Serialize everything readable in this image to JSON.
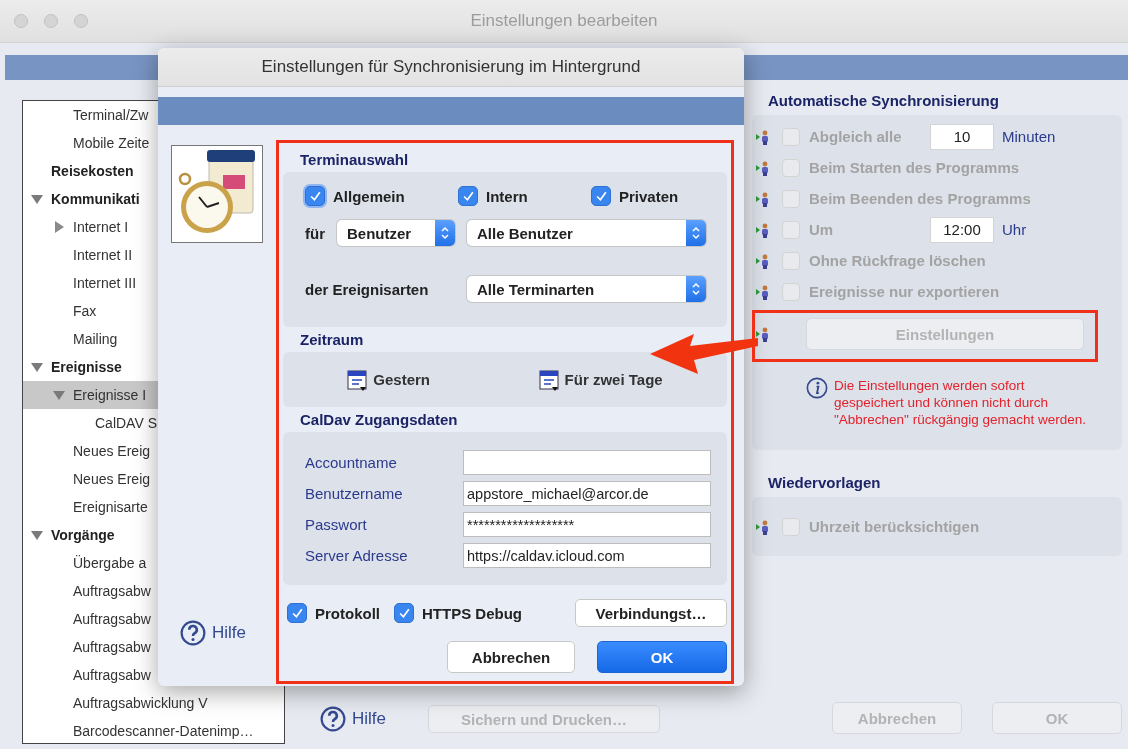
{
  "window": {
    "title": "Einstellungen bearbeiten"
  },
  "tree": [
    {
      "label": "Terminal/Zw",
      "kind": "item",
      "selected": false
    },
    {
      "label": "Mobile Zeite",
      "kind": "item",
      "selected": false
    },
    {
      "label": "Reisekosten",
      "kind": "category",
      "selected": false
    },
    {
      "label": "Kommunikati",
      "kind": "category",
      "selected": false,
      "expanded": true,
      "children": [
        {
          "label": "Internet I",
          "selected": false,
          "expanded": false
        },
        {
          "label": "Internet II",
          "selected": false
        },
        {
          "label": "Internet III",
          "selected": false
        },
        {
          "label": "Fax",
          "selected": false
        },
        {
          "label": "Mailing",
          "selected": false
        }
      ]
    },
    {
      "label": "Ereignisse",
      "kind": "category",
      "selected": false,
      "expanded": true,
      "children": [
        {
          "label": "Ereignisse I",
          "selected": true,
          "expanded": true,
          "children": [
            {
              "label": "CalDAV S",
              "selected": false
            }
          ]
        },
        {
          "label": "Neues Ereig",
          "selected": false
        },
        {
          "label": "Neues Ereig",
          "selected": false
        },
        {
          "label": "Ereignisarte",
          "selected": false
        }
      ]
    },
    {
      "label": "Vorgänge",
      "kind": "category",
      "selected": false,
      "expanded": true,
      "children": [
        {
          "label": "Übergabe a",
          "selected": false
        },
        {
          "label": "Auftragsabw",
          "selected": false
        },
        {
          "label": "Auftragsabw",
          "selected": false
        },
        {
          "label": "Auftragsabw",
          "selected": false
        },
        {
          "label": "Auftragsabw",
          "selected": false
        },
        {
          "label": "Auftragsabwicklung V",
          "selected": false
        },
        {
          "label": "Barcodescanner-Datenimp…",
          "selected": false
        }
      ]
    }
  ],
  "back_footer": {
    "help": "Hilfe",
    "print_button": {
      "label": "Sichern und Drucken…",
      "disabled": true
    }
  },
  "auto_sync": {
    "title": "Automatische Synchronisierung",
    "rows": [
      {
        "kind": "input",
        "label": "Abgleich alle",
        "checked": false,
        "disabled": true,
        "value": "10",
        "unit": "Minuten"
      },
      {
        "kind": "check",
        "label": "Beim Starten des Programms",
        "checked": false,
        "disabled": true
      },
      {
        "kind": "check",
        "label": "Beim Beenden des Programms",
        "checked": false,
        "disabled": true
      },
      {
        "kind": "input",
        "label": "Um",
        "checked": false,
        "disabled": true,
        "value": "12:00",
        "unit": "Uhr"
      },
      {
        "kind": "check",
        "label": "Ohne Rückfrage löschen",
        "checked": false,
        "disabled": true
      },
      {
        "kind": "check",
        "label": "Ereignisse nur exportieren",
        "checked": false,
        "disabled": true
      }
    ],
    "settings_button": {
      "label": "Einstellungen",
      "disabled": true
    },
    "note": "Die Einstellungen werden sofort gespeichert und können nicht durch \"Abbrechen\" rückgängig gemacht werden."
  },
  "wiedervorlagen": {
    "title": "Wiedervorlagen",
    "rows": [
      {
        "label": "Uhrzeit berücksichtigen",
        "checked": false,
        "disabled": true
      }
    ]
  },
  "back_buttons": [
    {
      "label": "Abbrechen",
      "disabled": true
    },
    {
      "label": "OK",
      "disabled": true
    }
  ],
  "dialog": {
    "title": "Einstellungen für Synchronisierung im Hintergrund",
    "help": "Hilfe",
    "terminauswahl": {
      "title": "Terminauswahl",
      "checkboxes": [
        {
          "label": "Allgemein",
          "checked": true,
          "focused": true
        },
        {
          "label": "Intern",
          "checked": true,
          "focused": false
        },
        {
          "label": "Privaten",
          "checked": true,
          "focused": false
        }
      ],
      "for_label": "für",
      "user_type": "Benutzer",
      "users": "Alle Benutzer",
      "types_label": "der Ereignisarten",
      "types": "Alle Terminarten"
    },
    "zeitraum": {
      "title": "Zeitraum",
      "buttons": [
        "Gestern",
        "Für zwei Tage"
      ]
    },
    "caldav": {
      "title": "CalDav Zugangsdaten",
      "fields": [
        {
          "label": "Accountname"
        },
        {
          "label": "Benutzername",
          "value": "appstore_michael@arcor.de"
        },
        {
          "label": "Passwort",
          "value": "*******************"
        },
        {
          "label": "Server Adresse",
          "value": "https://caldav.icloud.com"
        }
      ]
    },
    "options": [
      {
        "label": "Protokoll",
        "checked": true
      },
      {
        "label": "HTTPS Debug",
        "checked": true
      }
    ],
    "connection_button": "Verbindungst…",
    "cancel": "Abbrechen",
    "ok": "OK"
  }
}
